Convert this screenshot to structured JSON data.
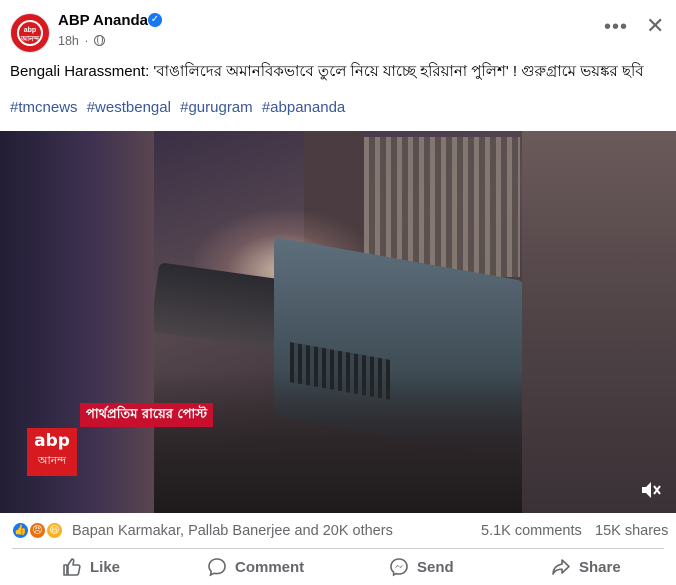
{
  "header": {
    "page_name": "ABP Ananda",
    "time": "18h",
    "avatar_text": "abp\nআনন্দ",
    "more_glyph": "•••",
    "close_glyph": "✕"
  },
  "post": {
    "message": "Bengali Harassment: 'বাঙালিদের অমানবিকভাবে তুলে নিয়ে যাচ্ছে হরিয়ানা পুলিশ' ! গুরুগ্রামে ভয়ঙ্কর ছবি",
    "hashtags": [
      "#tmcnews",
      "#westbengal",
      "#gurugram",
      "#abpananda"
    ]
  },
  "video": {
    "caption_banner": "পার্থপ্রতিম রায়ের পোস্ট",
    "logo_line1": "abp",
    "logo_line2": "আনন্দ",
    "muted": true
  },
  "stats": {
    "reactions": [
      "like",
      "angry",
      "haha"
    ],
    "reactor_names": "Bapan Karmakar, Pallab Banerjee and 20K others",
    "comments": "5.1K comments",
    "shares": "15K shares"
  },
  "actions": {
    "like": "Like",
    "comment": "Comment",
    "send": "Send",
    "share": "Share"
  },
  "colors": {
    "brand_red": "#d71920",
    "facebook_blue": "#1877f2",
    "hashtag_link": "#385898",
    "secondary_text": "#65676b"
  }
}
